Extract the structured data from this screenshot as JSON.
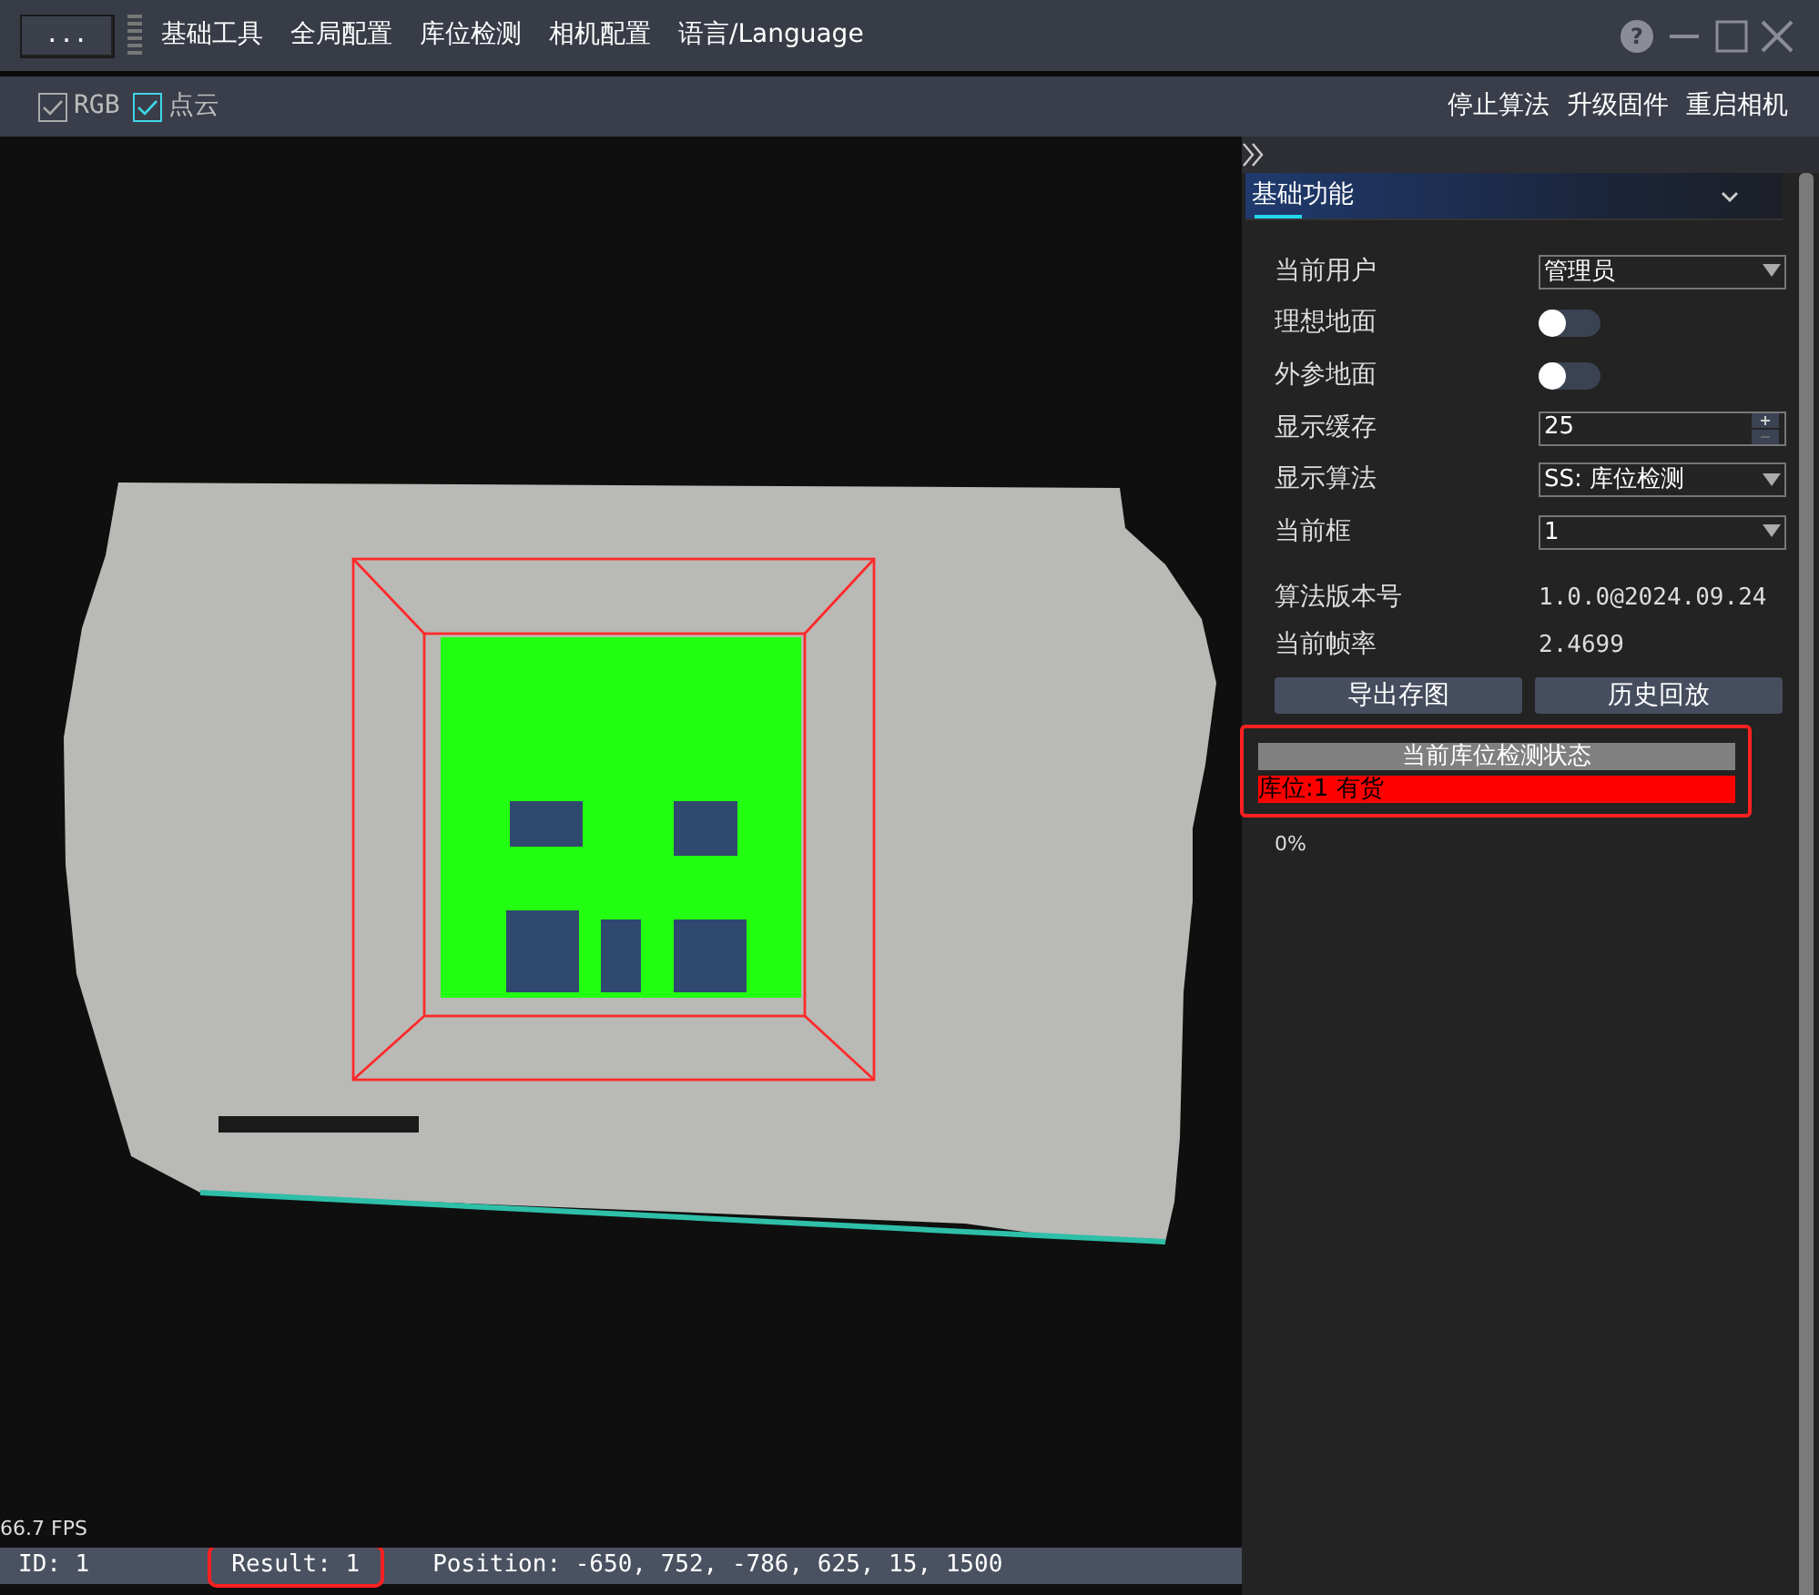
{
  "title_bar": {
    "more_button": "...",
    "help_button": "?",
    "menus": [
      "基础工具",
      "全局配置",
      "库位检测",
      "相机配置",
      "语言/Language"
    ]
  },
  "toolbar": {
    "checkboxes": [
      {
        "label": "RGB",
        "checked": true,
        "focused": false
      },
      {
        "label": "点云",
        "checked": true,
        "focused": true
      }
    ],
    "actions": [
      "停止算法",
      "升级固件",
      "重启相机"
    ]
  },
  "viewport": {
    "fps": "66.7 FPS"
  },
  "status_bar": {
    "items": [
      {
        "text": "ID: 1",
        "highlighted": false
      },
      {
        "text": "Result: 1",
        "highlighted": true
      },
      {
        "text": "Position: -650, 752, -786, 625, 15, 1500",
        "highlighted": false
      }
    ]
  },
  "panel": {
    "section": {
      "title": "基础功能",
      "expanded": true
    },
    "rows": [
      {
        "kind": "select",
        "label": "当前用户",
        "value": "管理员"
      },
      {
        "kind": "toggle",
        "label": "理想地面",
        "on": false
      },
      {
        "kind": "toggle",
        "label": "外参地面",
        "on": false
      },
      {
        "kind": "spin",
        "label": "显示缓存",
        "value": "25"
      },
      {
        "kind": "select",
        "label": "显示算法",
        "value": "SS: 库位检测"
      },
      {
        "kind": "select",
        "label": "当前框",
        "value": "1"
      }
    ],
    "info": [
      {
        "label": "算法版本号",
        "value": "1.0.0@2024.09.24"
      },
      {
        "label": "当前帧率",
        "value": "2.4699"
      }
    ],
    "buttons": [
      "导出存图",
      "历史回放"
    ],
    "status": {
      "title": "当前库位检测状态",
      "highlighted": true,
      "items": [
        {
          "text": "库位:1 有货",
          "color": "#ff0000"
        }
      ]
    },
    "progress_text": "0%"
  }
}
